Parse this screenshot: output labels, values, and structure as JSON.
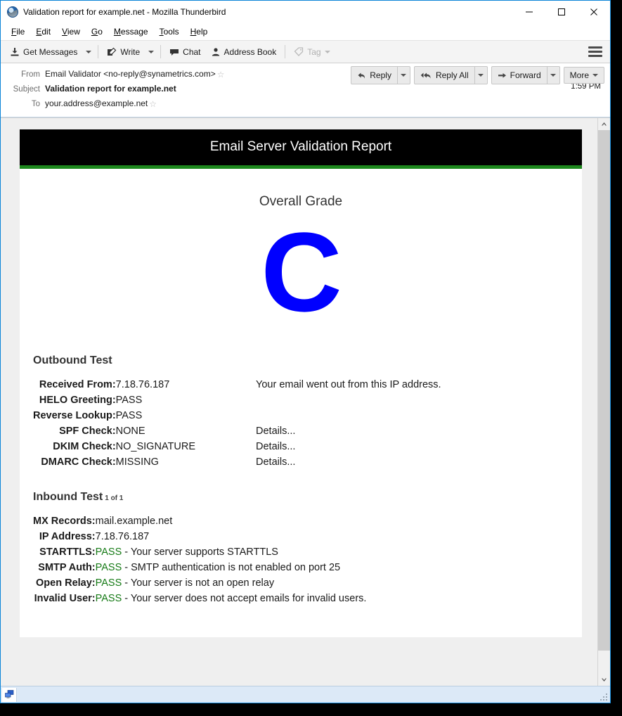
{
  "window": {
    "title": "Validation report for example.net - Mozilla Thunderbird",
    "app_icon": "thunderbird-icon",
    "controls": {
      "minimize": "minimize-icon",
      "maximize": "maximize-icon",
      "close": "close-icon"
    }
  },
  "menubar": {
    "items": [
      {
        "label": "File",
        "access_key": "F"
      },
      {
        "label": "Edit",
        "access_key": "E"
      },
      {
        "label": "View",
        "access_key": "V"
      },
      {
        "label": "Go",
        "access_key": "G"
      },
      {
        "label": "Message",
        "access_key": "M"
      },
      {
        "label": "Tools",
        "access_key": "T"
      },
      {
        "label": "Help",
        "access_key": "H"
      }
    ]
  },
  "toolbar": {
    "get_messages": "Get Messages",
    "write": "Write",
    "chat": "Chat",
    "address_book": "Address Book",
    "tag": "Tag",
    "menu_button": "app-menu-icon"
  },
  "message_header": {
    "from_label": "From",
    "from_value": "Email Validator <no-reply@synametrics.com>",
    "subject_label": "Subject",
    "subject_value": "Validation report for example.net",
    "to_label": "To",
    "to_value": "your.address@example.net",
    "time": "1:59 PM",
    "actions": {
      "reply": "Reply",
      "reply_all": "Reply All",
      "forward": "Forward",
      "more": "More"
    }
  },
  "report": {
    "title": "Email Server Validation Report",
    "accent_color": "#1c871c",
    "grade_label": "Overall Grade",
    "grade_value": "C",
    "grade_color": "#0000ff",
    "outbound": {
      "heading": "Outbound Test",
      "rows": [
        {
          "label": "Received From:",
          "value": "7.18.76.187",
          "value_type": "plain",
          "note": "Your email went out from this IP address.",
          "details": ""
        },
        {
          "label": "HELO Greeting:",
          "value": "PASS",
          "value_type": "pass",
          "note": "",
          "details": ""
        },
        {
          "label": "Reverse Lookup:",
          "value": "PASS",
          "value_type": "pass",
          "note": "",
          "details": ""
        },
        {
          "label": "SPF Check:",
          "value": "NONE",
          "value_type": "plain",
          "note": "",
          "details": "Details..."
        },
        {
          "label": "DKIM Check:",
          "value": "NO_SIGNATURE",
          "value_type": "plain",
          "note": "",
          "details": "Details..."
        },
        {
          "label": "DMARC Check:",
          "value": "MISSING",
          "value_type": "plain",
          "note": "",
          "details": "Details..."
        }
      ]
    },
    "inbound": {
      "heading": "Inbound Test",
      "counter": "1 of 1",
      "rows": [
        {
          "label": "MX Records:",
          "value": "mail.example.net",
          "value_type": "plain",
          "note": ""
        },
        {
          "label": "IP Address:",
          "value": "7.18.76.187",
          "value_type": "plain",
          "note": ""
        },
        {
          "label": "STARTTLS:",
          "value": "PASS",
          "value_type": "pass",
          "note": " - Your server supports STARTTLS"
        },
        {
          "label": "SMTP Auth:",
          "value": "PASS",
          "value_type": "pass",
          "note": " - SMTP authentication is not enabled on port 25"
        },
        {
          "label": "Open Relay:",
          "value": "PASS",
          "value_type": "pass",
          "note": " - Your server is not an open relay"
        },
        {
          "label": "Invalid User:",
          "value": "PASS",
          "value_type": "pass",
          "note": " - Your server does not accept emails for invalid users."
        }
      ]
    }
  },
  "scrollbar": {
    "up_arrow": "chevron-up-icon",
    "down_arrow": "chevron-down-icon"
  },
  "statusbar": {
    "icon": "connection-icon",
    "text": ""
  }
}
